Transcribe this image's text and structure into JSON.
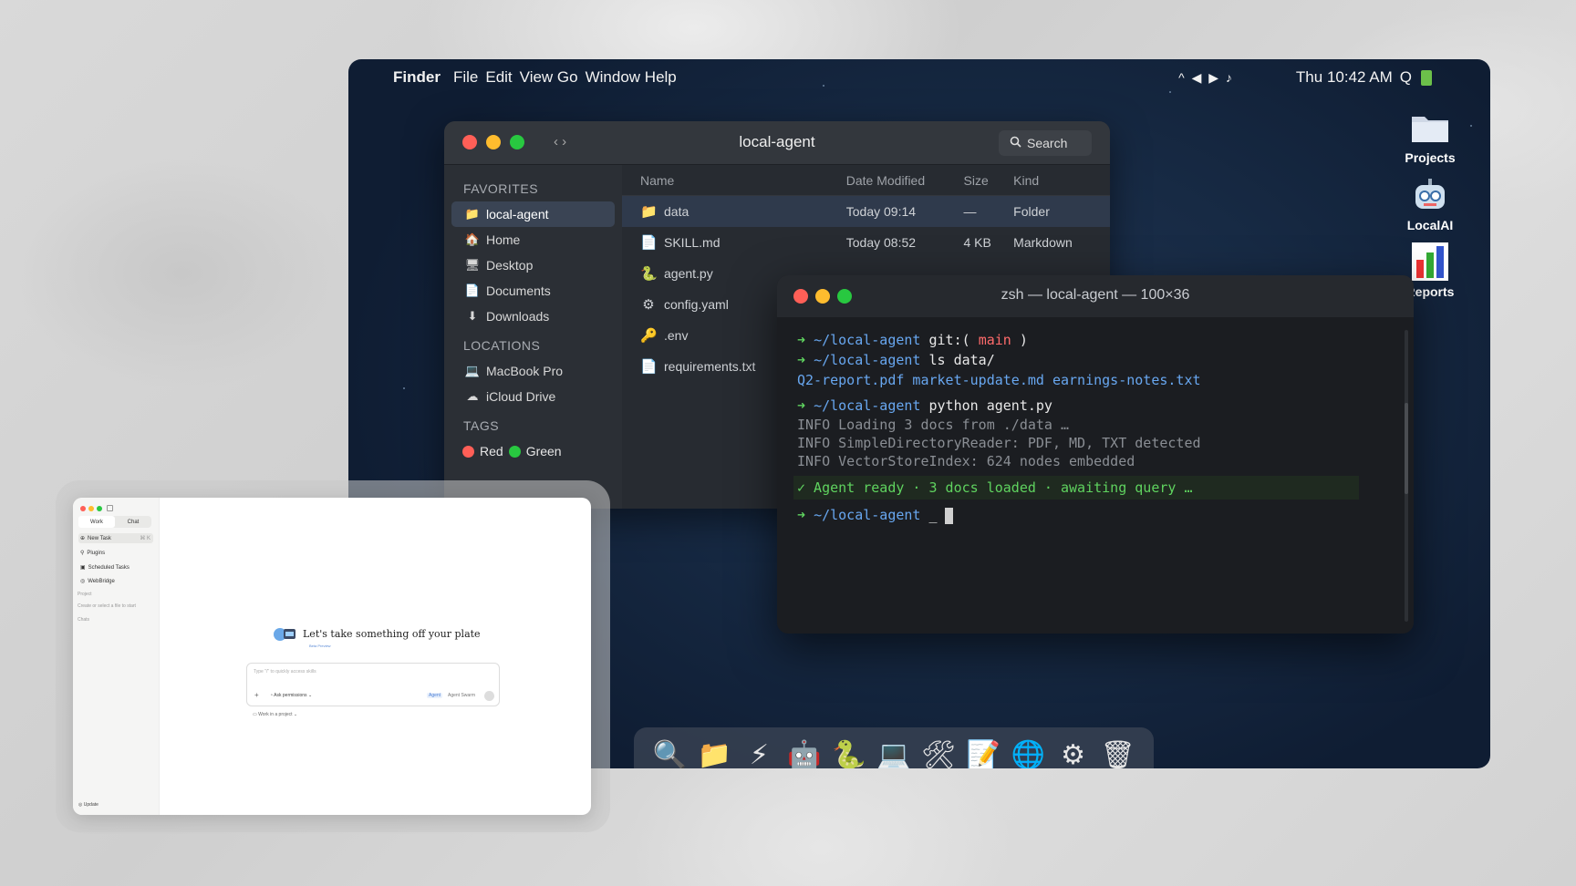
{
  "menubar": {
    "app": "Finder",
    "menus": [
      "File",
      "Edit",
      "View Go",
      "Window Help"
    ],
    "media_controls": "^ ◀ ▶ ♪",
    "clock": "Thu 10:42 AM",
    "search_glyph": "Q"
  },
  "desktop_icons": [
    {
      "label": "Projects",
      "icon": "folder-icon"
    },
    {
      "label": "LocalAI",
      "icon": "robot-icon"
    },
    {
      "label": "Reports",
      "icon": "chart-icon"
    }
  ],
  "finder": {
    "title": "local-agent",
    "nav": "‹ ›",
    "search_label": "Search",
    "sections": {
      "favorites": "FAVORITES",
      "locations": "LOCATIONS",
      "tags": "TAGS"
    },
    "favorites": [
      "local-agent",
      "Home",
      "Desktop",
      "Documents",
      "Downloads"
    ],
    "locations": [
      "MacBook Pro",
      "iCloud Drive"
    ],
    "tags": [
      {
        "label": "Red",
        "color": "#ff5f57"
      },
      {
        "label": "Green",
        "color": "#28c840"
      }
    ],
    "columns": [
      "Name",
      "Date Modified",
      "Size",
      "Kind"
    ],
    "rows": [
      {
        "name": "data",
        "date": "Today 09:14",
        "size": "—",
        "kind": "Folder",
        "icon": "folder-icon"
      },
      {
        "name": "SKILL.md",
        "date": "Today 08:52",
        "size": "4 KB",
        "kind": "Markdown",
        "icon": "document-icon"
      },
      {
        "name": "agent.py",
        "date": "",
        "size": "",
        "kind": "",
        "icon": "python-icon"
      },
      {
        "name": "config.yaml",
        "date": "",
        "size": "",
        "kind": "",
        "icon": "gear-icon"
      },
      {
        "name": ".env",
        "date": "",
        "size": "",
        "kind": "",
        "icon": "key-icon"
      },
      {
        "name": "requirements.txt",
        "date": "",
        "size": "",
        "kind": "",
        "icon": "document-icon"
      }
    ]
  },
  "terminal": {
    "title": "zsh — local-agent — 100×36",
    "prompt": "~/local-agent",
    "lines": {
      "l1_cmd": "git:(",
      "l1_branch": "main",
      "l1_end": ")",
      "l2_cmd": "ls data/",
      "l3_files": "Q2-report.pdf market-update.md earnings-notes.txt",
      "l4_cmd": "python agent.py",
      "info1": "INFO Loading 3 docs from ./data …",
      "info2": "INFO SimpleDirectoryReader: PDF, MD, TXT detected",
      "info3": "INFO VectorStoreIndex: 624 nodes embedded",
      "ready": "✓ Agent ready · 3 docs loaded · awaiting query …",
      "last_cmd": "_"
    }
  },
  "dock": [
    "search-icon",
    "folder-icon",
    "bolt-icon",
    "robot-icon",
    "python-icon",
    "laptop-icon",
    "tools-icon",
    "notepad-icon",
    "globe-icon",
    "gear-icon",
    "trash-icon"
  ],
  "app_window": {
    "tabs": [
      "Work",
      "Chat"
    ],
    "sidebar": [
      "New Task",
      "Plugins",
      "Scheduled Tasks",
      "WebBridge"
    ],
    "new_task_shortcut": "⌘ K",
    "project_label": "Project",
    "project_hint": "Create or select a file to start",
    "chats_label": "Chats",
    "update": "Update",
    "greeting": "Let's take something off your plate",
    "beta": "Beta Preview",
    "input_placeholder": "Type \"/\" to quickly access skills",
    "ask_permissions": "Ask permissions",
    "agent": "Agent",
    "agent_swarm": "Agent Swarm",
    "work_in_project": "Work in a project"
  }
}
